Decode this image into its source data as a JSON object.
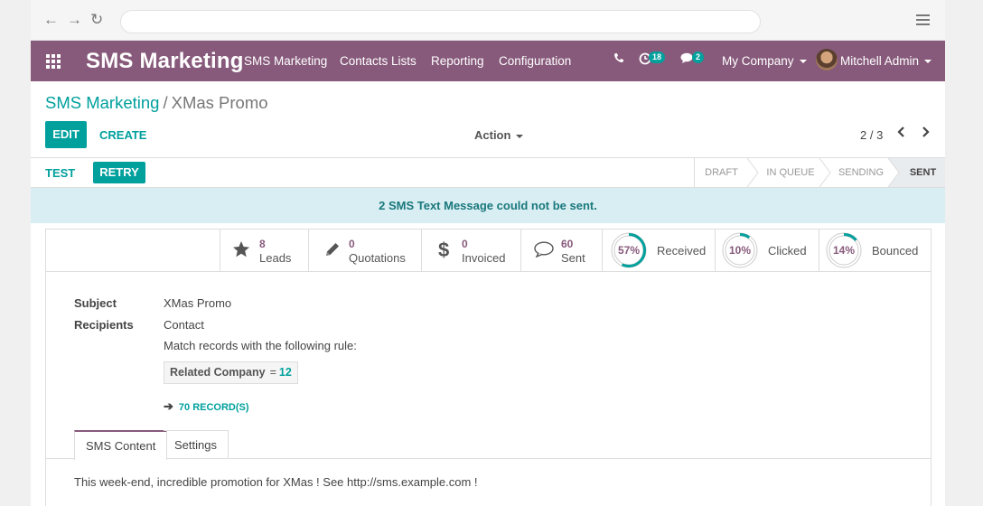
{
  "browser": {
    "back": "←",
    "forward": "→",
    "reload": "↻"
  },
  "nav": {
    "brand": "SMS Marketing",
    "menu": [
      "SMS Marketing",
      "Contacts Lists",
      "Reporting",
      "Configuration"
    ],
    "activity_count": "18",
    "message_count": "2",
    "company": "My Company",
    "user": "Mitchell Admin"
  },
  "breadcrumb": {
    "parent": "SMS Marketing",
    "separator": "/",
    "current": "XMas Promo"
  },
  "control": {
    "edit": "EDIT",
    "create": "CREATE",
    "action": "Action",
    "pager": "2 / 3"
  },
  "statusbar": {
    "test": "TEST",
    "retry": "RETRY",
    "stages": [
      "DRAFT",
      "IN QUEUE",
      "SENDING",
      "SENT"
    ],
    "active_stage": "SENT"
  },
  "alert": "2  SMS Text Message could not be sent.",
  "stats": {
    "leads": {
      "value": "8",
      "label": "Leads"
    },
    "quotations": {
      "value": "0",
      "label": "Quotations"
    },
    "invoiced": {
      "value": "0",
      "label": "Invoiced"
    },
    "sent": {
      "value": "60",
      "label": "Sent"
    },
    "received": {
      "percent": "57%",
      "fraction": 0.57,
      "label": "Received"
    },
    "clicked": {
      "percent": "10%",
      "fraction": 0.1,
      "label": "Clicked"
    },
    "bounced": {
      "percent": "14%",
      "fraction": 0.14,
      "label": "Bounced"
    }
  },
  "form": {
    "subject_label": "Subject",
    "subject_value": "XMas Promo",
    "recipients_label": "Recipients",
    "recipients_value": "Contact",
    "rule_text": "Match records with the following rule:",
    "domain_field": "Related Company",
    "domain_op": "=",
    "domain_value": "12",
    "records": "70 RECORD(S)"
  },
  "tabs": [
    "SMS Content",
    "Settings"
  ],
  "sms_content": "This week-end, incredible promotion for XMas ! See http://sms.example.com !",
  "colors": {
    "primary": "#875a7b",
    "accent": "#00a09d",
    "alert_bg": "#d9eef2"
  }
}
